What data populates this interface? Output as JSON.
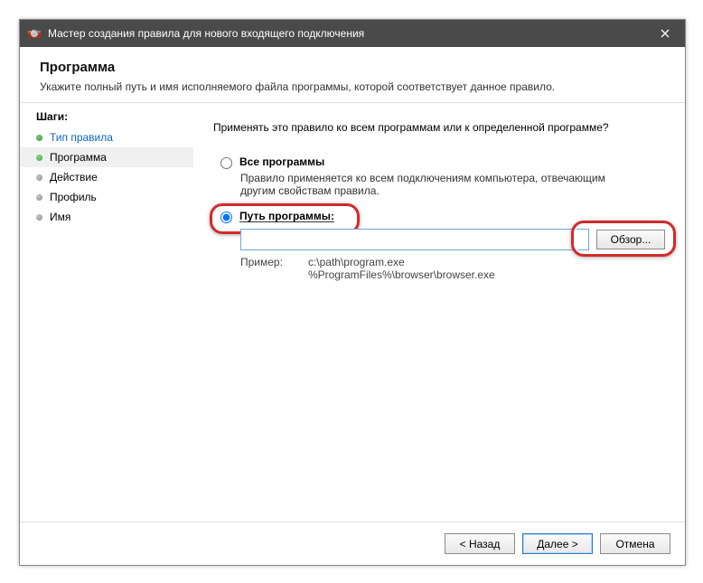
{
  "window": {
    "title": "Мастер создания правила для нового входящего подключения"
  },
  "header": {
    "title": "Программа",
    "subtitle": "Укажите полный путь и имя исполняемого файла программы, которой соответствует данное правило."
  },
  "sidebar": {
    "steps_label": "Шаги:",
    "items": [
      {
        "label": "Тип правила"
      },
      {
        "label": "Программа"
      },
      {
        "label": "Действие"
      },
      {
        "label": "Профиль"
      },
      {
        "label": "Имя"
      }
    ]
  },
  "main": {
    "prompt": "Применять это правило ко всем программам или к определенной программе?",
    "opt_all": {
      "label": "Все программы",
      "desc": "Правило применяется ко всем подключениям компьютера, отвечающим другим свойствам правила."
    },
    "opt_path": {
      "label": "Путь программы:",
      "value": "",
      "browse": "Обзор...",
      "example_label": "Пример:",
      "example_text": "c:\\path\\program.exe\n%ProgramFiles%\\browser\\browser.exe"
    }
  },
  "footer": {
    "back": "< Назад",
    "next": "Далее >",
    "cancel": "Отмена"
  }
}
